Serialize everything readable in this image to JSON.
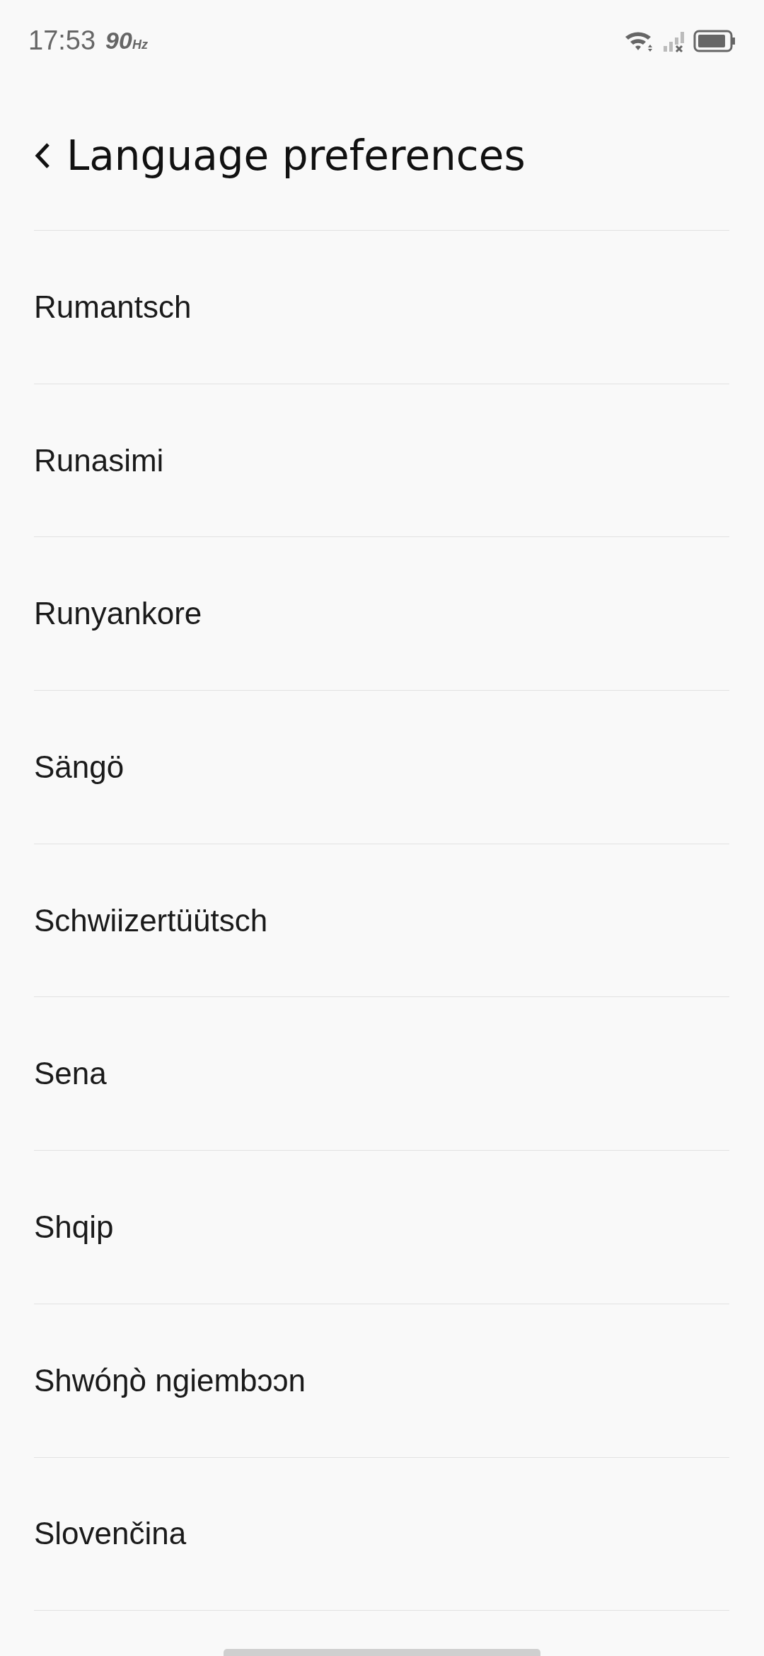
{
  "status_bar": {
    "time": "17:53",
    "refresh_rate": "90$_{Hz}$"
  },
  "header": {
    "title": "Language preferences"
  },
  "languages": [
    {
      "label": "Rumantsch"
    },
    {
      "label": "Runasimi"
    },
    {
      "label": "Runyankore"
    },
    {
      "label": "Sängö"
    },
    {
      "label": "Schwiizertüütsch"
    },
    {
      "label": "Sena"
    },
    {
      "label": "Shqip"
    },
    {
      "label": "Shwóŋò ngiembɔɔn"
    },
    {
      "label": "Slovenčina"
    }
  ]
}
